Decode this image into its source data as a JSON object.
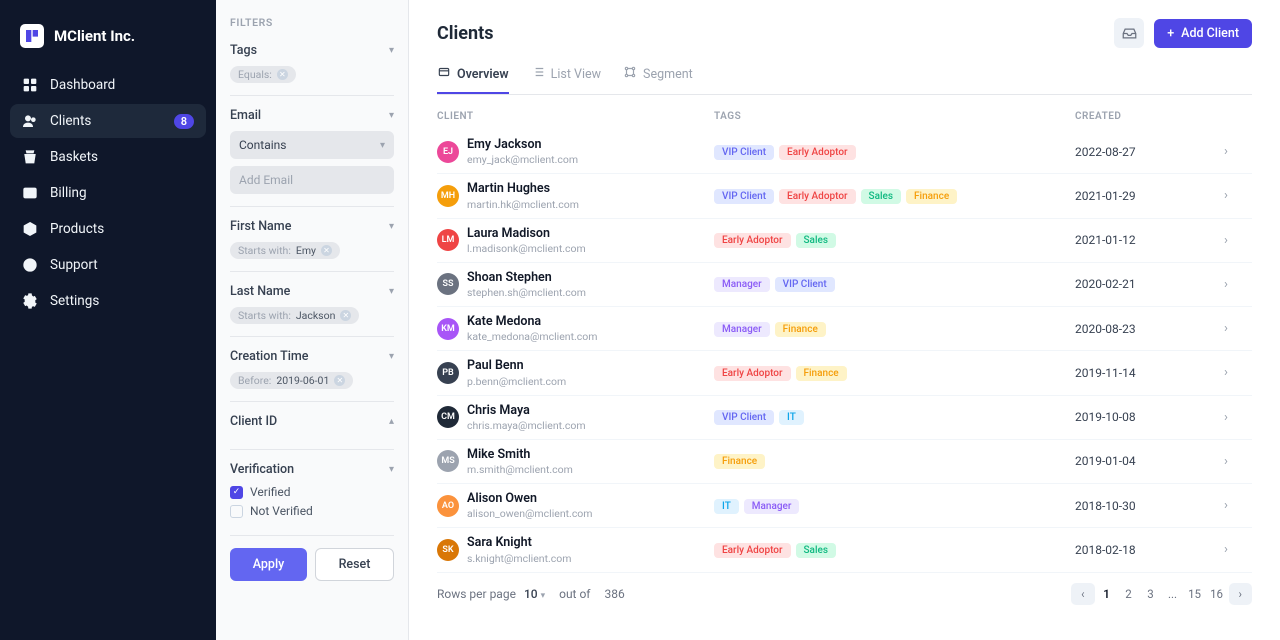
{
  "brand": {
    "name": "MClient Inc."
  },
  "sidebar": {
    "items": [
      {
        "label": "Dashboard"
      },
      {
        "label": "Clients",
        "badge": "8"
      },
      {
        "label": "Baskets"
      },
      {
        "label": "Billing"
      },
      {
        "label": "Products"
      },
      {
        "label": "Support"
      },
      {
        "label": "Settings"
      }
    ]
  },
  "filters": {
    "title": "FILTERS",
    "tags": {
      "label": "Tags",
      "chip_pre": "Equals:"
    },
    "email": {
      "label": "Email",
      "operator": "Contains",
      "placeholder": "Add Email"
    },
    "first_name": {
      "label": "First Name",
      "chip_pre": "Starts with:",
      "value": "Emy"
    },
    "last_name": {
      "label": "Last Name",
      "chip_pre": "Starts with:",
      "value": "Jackson"
    },
    "creation": {
      "label": "Creation Time",
      "chip_pre": "Before:",
      "value": "2019-06-01"
    },
    "client_id": {
      "label": "Client ID"
    },
    "verification": {
      "label": "Verification",
      "verified": "Verified",
      "not_verified": "Not Verified"
    },
    "apply": "Apply",
    "reset": "Reset"
  },
  "header": {
    "title": "Clients",
    "add_label": "Add Client"
  },
  "tabs": [
    {
      "label": "Overview"
    },
    {
      "label": "List View"
    },
    {
      "label": "Segment"
    }
  ],
  "columns": {
    "client": "CLIENT",
    "tags": "TAGS",
    "created": "CREATED"
  },
  "tags_palette": {
    "VIP Client": "t-vip",
    "Early Adoptor": "t-early",
    "Sales": "t-sales",
    "Finance": "t-finance",
    "Manager": "t-manager",
    "IT": "t-it"
  },
  "clients": [
    {
      "name": "Emy Jackson",
      "email": "emy_jack@mclient.com",
      "tags": [
        "VIP Client",
        "Early Adoptor"
      ],
      "created": "2022-08-27",
      "avc": "#ec4899"
    },
    {
      "name": "Martin Hughes",
      "email": "martin.hk@mclient.com",
      "tags": [
        "VIP Client",
        "Early Adoptor",
        "Sales",
        "Finance"
      ],
      "created": "2021-01-29",
      "avc": "#f59e0b"
    },
    {
      "name": "Laura Madison",
      "email": "l.madisonk@mclient.com",
      "tags": [
        "Early Adoptor",
        "Sales"
      ],
      "created": "2021-01-12",
      "avc": "#ef4444"
    },
    {
      "name": "Shoan Stephen",
      "email": "stephen.sh@mclient.com",
      "tags": [
        "Manager",
        "VIP Client"
      ],
      "created": "2020-02-21",
      "avc": "#6b7280"
    },
    {
      "name": "Kate Medona",
      "email": "kate_medona@mclient.com",
      "tags": [
        "Manager",
        "Finance"
      ],
      "created": "2020-08-23",
      "avc": "#a855f7"
    },
    {
      "name": "Paul Benn",
      "email": "p.benn@mclient.com",
      "tags": [
        "Early Adoptor",
        "Finance"
      ],
      "created": "2019-11-14",
      "avc": "#374151"
    },
    {
      "name": "Chris Maya",
      "email": "chris.maya@mclient.com",
      "tags": [
        "VIP Client",
        "IT"
      ],
      "created": "2019-10-08",
      "avc": "#1f2937"
    },
    {
      "name": "Mike Smith",
      "email": "m.smith@mclient.com",
      "tags": [
        "Finance"
      ],
      "created": "2019-01-04",
      "avc": "#9ca3af"
    },
    {
      "name": "Alison Owen",
      "email": "alison_owen@mclient.com",
      "tags": [
        "IT",
        "Manager"
      ],
      "created": "2018-10-30",
      "avc": "#fb923c"
    },
    {
      "name": "Sara Knight",
      "email": "s.knight@mclient.com",
      "tags": [
        "Early Adoptor",
        "Sales"
      ],
      "created": "2018-02-18",
      "avc": "#d97706"
    }
  ],
  "footer": {
    "rows_label": "Rows per page",
    "rows_value": "10",
    "out_of_label": "out of",
    "total": "386",
    "pages": [
      "1",
      "2",
      "3",
      "...",
      "15",
      "16"
    ]
  }
}
